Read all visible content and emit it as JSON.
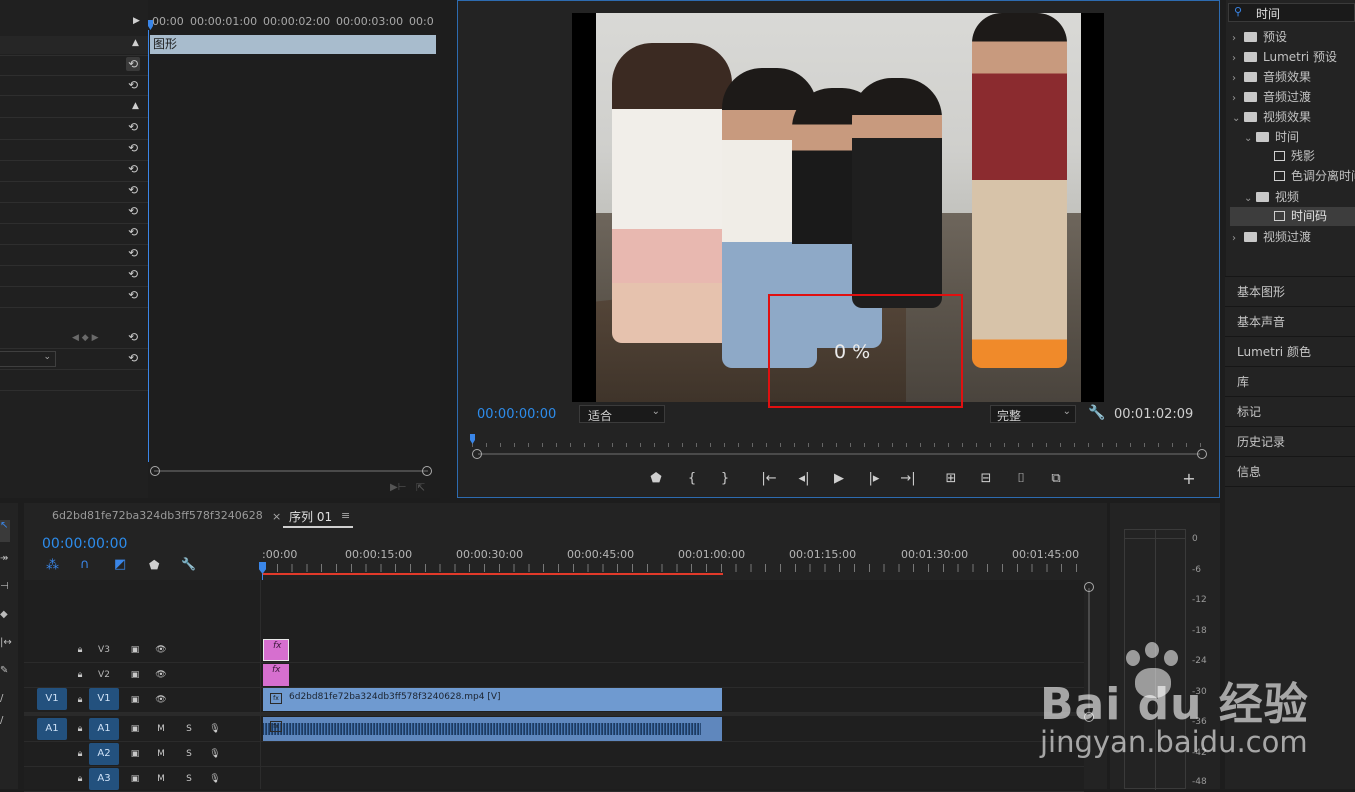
{
  "effect_controls": {
    "tc_labels": [
      "00:00",
      "00:00:01:00",
      "00:00:02:00",
      "00:00:03:00",
      "00:0"
    ],
    "clip_label": "图形"
  },
  "program": {
    "current_tc": "00:00:00:00",
    "fit": "适合",
    "quality": "完整",
    "duration": "00:01:02:09",
    "overlay_text": "0 %"
  },
  "effects_panel": {
    "search_value": "时间",
    "tree": [
      {
        "label": "预设"
      },
      {
        "label": "Lumetri 预设"
      },
      {
        "label": "音频效果"
      },
      {
        "label": "音频过渡"
      },
      {
        "label": "视频效果"
      },
      {
        "label": "时间"
      },
      {
        "label": "残影"
      },
      {
        "label": "色调分离时间"
      },
      {
        "label": "视频"
      },
      {
        "label": "时间码"
      },
      {
        "label": "视频过渡"
      }
    ],
    "tabs": [
      "基本图形",
      "基本声音",
      "Lumetri 颜色",
      "库",
      "标记",
      "历史记录",
      "信息"
    ]
  },
  "timeline": {
    "tab_inactive": "6d2bd81fe72ba324db3ff578f3240628",
    "tab_active": "序列 01",
    "tab_close": "×",
    "current_tc": "00:00:00:00",
    "ruler": [
      ":00:00",
      "00:00:15:00",
      "00:00:30:00",
      "00:00:45:00",
      "00:01:00:00",
      "00:01:15:00",
      "00:01:30:00",
      "00:01:45:00"
    ],
    "video_tracks": [
      {
        "name": "V3"
      },
      {
        "name": "V2"
      },
      {
        "src": "V1",
        "name": "V1"
      }
    ],
    "audio_tracks": [
      {
        "src": "A1",
        "name": "A1"
      },
      {
        "name": "A2"
      },
      {
        "name": "A3"
      }
    ],
    "ms_m": "M",
    "ms_s": "S",
    "fx_label": "fx",
    "clip_name": "6d2bd81fe72ba324db3ff578f3240628.mp4 [V]"
  },
  "meter": {
    "labels": [
      "0",
      "-6",
      "-12",
      "-18",
      "-24",
      "-30",
      "-36",
      "-42",
      "-48"
    ]
  },
  "watermark": {
    "text": "Bai du 经验",
    "url": "jingyan.baidu.com"
  },
  "colors": {
    "accent_blue": "#2d8ceb",
    "active_track": "#23517e",
    "clip_blue": "#6f9ad0",
    "graphic_pink": "#d66fcf",
    "playhead_blue": "#3a86e8",
    "red_box": "#e01010"
  }
}
